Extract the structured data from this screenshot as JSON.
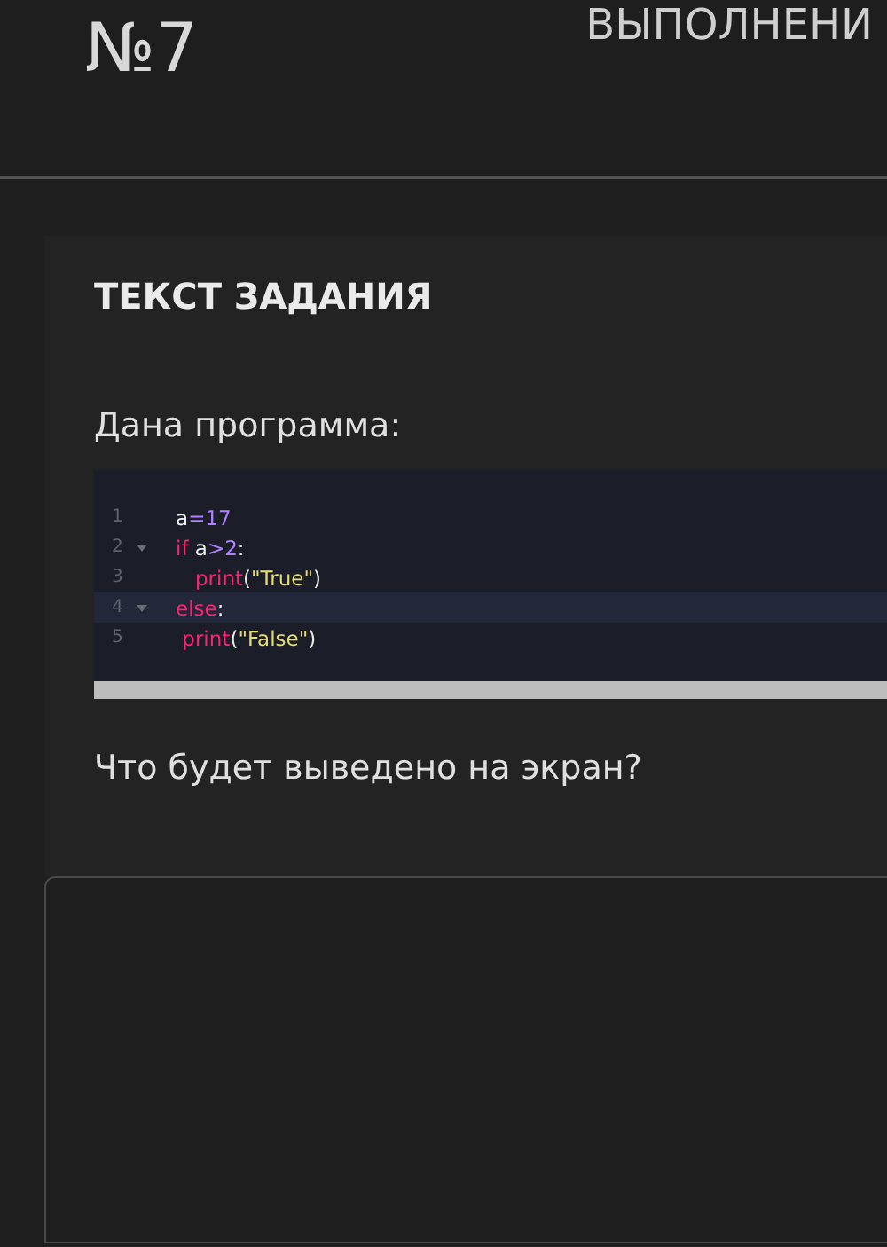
{
  "header": {
    "number": "№7",
    "title": "ВЫПОЛНЕНИ"
  },
  "task": {
    "heading": "ТЕКСТ ЗАДАНИЯ",
    "intro": "Дана программа:",
    "code": {
      "lines": [
        {
          "number": "1",
          "fold": false,
          "active": false,
          "tokens": [
            {
              "kind": "var",
              "text": "a"
            },
            {
              "kind": "number",
              "text": "=17"
            }
          ]
        },
        {
          "number": "2",
          "fold": true,
          "active": false,
          "tokens": [
            {
              "kind": "keyword",
              "text": "if "
            },
            {
              "kind": "var",
              "text": "a"
            },
            {
              "kind": "number",
              "text": ">2"
            },
            {
              "kind": "plain",
              "text": ":"
            }
          ]
        },
        {
          "number": "3",
          "fold": false,
          "active": false,
          "tokens": [
            {
              "kind": "keyword",
              "text": "   print"
            },
            {
              "kind": "plain",
              "text": "("
            },
            {
              "kind": "string",
              "text": "\"True\""
            },
            {
              "kind": "plain",
              "text": ")"
            }
          ]
        },
        {
          "number": "4",
          "fold": true,
          "active": true,
          "tokens": [
            {
              "kind": "keyword",
              "text": "else"
            },
            {
              "kind": "plain",
              "text": ":"
            }
          ]
        },
        {
          "number": "5",
          "fold": false,
          "active": false,
          "tokens": [
            {
              "kind": "keyword",
              "text": " print"
            },
            {
              "kind": "plain",
              "text": "("
            },
            {
              "kind": "string",
              "text": "\"False\""
            },
            {
              "kind": "plain",
              "text": ")"
            }
          ]
        }
      ]
    },
    "question": "Что будет выведено на экран?"
  }
}
